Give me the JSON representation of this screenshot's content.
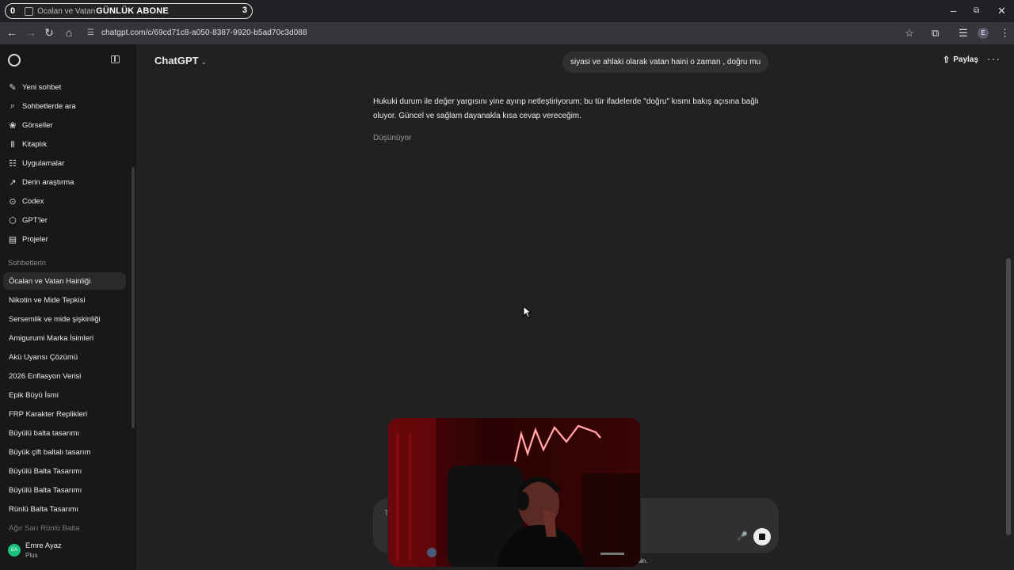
{
  "browser": {
    "tab_sound_label": "0",
    "tab_title": "Öcalan ve Vatan Hain",
    "overlay_text": "GÜNLÜK ABONE",
    "overlay_count": "3",
    "url": "chatgpt.com/c/69cd71c8-a050-8387-9920-b5ad70c3d088",
    "profile_initial": "E"
  },
  "sidebar": {
    "menu": [
      {
        "label": "Yeni sohbet",
        "icon": "edit-icon"
      },
      {
        "label": "Sohbetlerde ara",
        "icon": "search-icon"
      },
      {
        "label": "Görseller",
        "icon": "images-icon"
      },
      {
        "label": "Kitaplık",
        "icon": "library-icon"
      },
      {
        "label": "Uygulamalar",
        "icon": "apps-icon"
      },
      {
        "label": "Derin araştırma",
        "icon": "telescope-icon"
      },
      {
        "label": "Codex",
        "icon": "codex-icon"
      },
      {
        "label": "GPT'ler",
        "icon": "gpts-icon"
      },
      {
        "label": "Projeler",
        "icon": "folder-icon"
      }
    ],
    "section_label": "Sohbetlerin",
    "chats": [
      "Öcalan ve Vatan Hainliği",
      "Nikotin ve Mide Tepkisi",
      "Sersemlik ve mide şişkinliği",
      "Amigurumi Marka İsimleri",
      "Akü Uyarısı Çözümü",
      "2026 Enflasyon Verisi",
      "Epik Büyü İsmi",
      "FRP Karakter Replikleri",
      "Büyülü balta tasarımı",
      "Büyük çift baltalı tasarım",
      "Büyülü Balta Tasarımı",
      "Büyülü Balta Tasarımı",
      "Rünlü Balta Tasarımı",
      "Ağır Sarı Rünlü Balta"
    ],
    "active_chat_index": 0,
    "user": {
      "initials": "EA",
      "name": "Emre Ayaz",
      "plan": "Plus"
    }
  },
  "header": {
    "model": "ChatGPT",
    "share_label": "Paylaş"
  },
  "conversation": {
    "user_message": "siyasi ve ahlaki olarak vatan haini o zaman , doğru mu",
    "assistant_text": "Hukuki durum ile değer yargısını yine ayırıp netleştiriyorum; bu tür ifadelerde \"doğru\" kısmı bakış açısına bağlı oluyor. Güncel ve sağlam dayanakla kısa cevap vereceğim.",
    "thinking_label": "Düşünüyor"
  },
  "composer": {
    "placeholder": "T",
    "disclaimer_tail": "edin."
  },
  "colors": {
    "sidebar_bg": "#181818",
    "main_bg": "#212121",
    "bubble_bg": "#303030",
    "avatar_bg": "#19c37d"
  }
}
